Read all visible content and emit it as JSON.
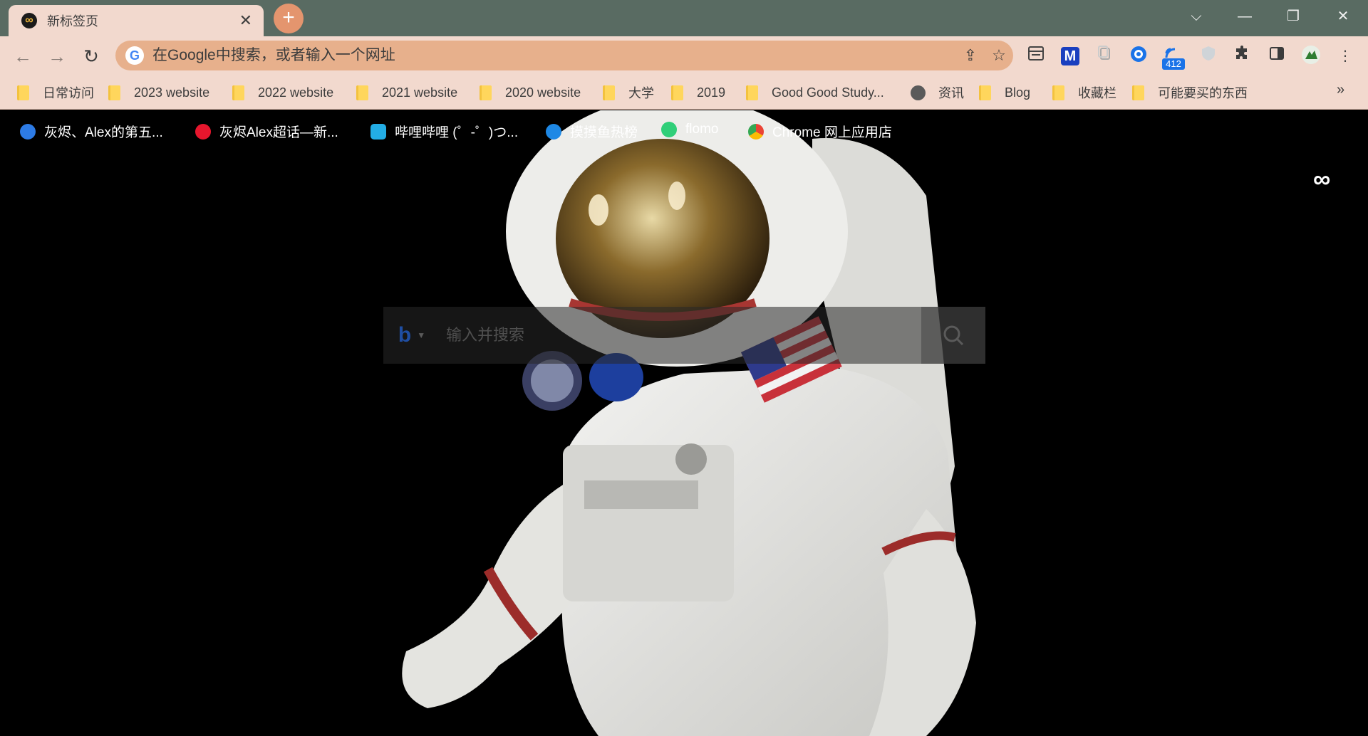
{
  "tab": {
    "title": "新标签页",
    "close": "✕",
    "favicon": "∞"
  },
  "newtab": {
    "label": "+"
  },
  "window": {
    "dropdown": "⌵",
    "minimize": "—",
    "restore": "❐",
    "close": "✕"
  },
  "nav": {
    "back": "←",
    "forward": "→",
    "reload": "↻"
  },
  "omnibox": {
    "placeholder": "在Google中搜索，或者输入一个网址",
    "logo": "G",
    "share": "⇪",
    "star": "☆"
  },
  "extensions": {
    "badge_count": "412",
    "m_label": "M",
    "puzzle": "✦",
    "menu": "⋮"
  },
  "bookmarks": [
    {
      "label": "日常访问",
      "type": "folder"
    },
    {
      "label": "2023 website",
      "type": "folder"
    },
    {
      "label": "2022 website",
      "type": "folder"
    },
    {
      "label": "2021 website",
      "type": "folder"
    },
    {
      "label": "2020 website",
      "type": "folder"
    },
    {
      "label": "大学",
      "type": "folder"
    },
    {
      "label": "2019",
      "type": "folder"
    },
    {
      "label": "Good Good Study...",
      "type": "folder"
    },
    {
      "label": "资讯",
      "type": "globe"
    },
    {
      "label": "Blog",
      "type": "folder"
    },
    {
      "label": "收藏栏",
      "type": "folder"
    },
    {
      "label": "可能要买的东西",
      "type": "folder"
    }
  ],
  "bookmarks_more": "»",
  "shortcuts": [
    {
      "label": "灰烬、Alex的第五...",
      "color": "#2d7be5"
    },
    {
      "label": "灰烬Alex超话—新...",
      "color": "#e6162d"
    },
    {
      "label": "哔哩哔哩 (゜-゜)つ...",
      "color": "#23ade5"
    },
    {
      "label": "摸摸鱼热榜",
      "color": "#1e88e5"
    },
    {
      "label": "flomo",
      "color": "#30cf79"
    },
    {
      "label": "Chrome 网上应用店",
      "color": "#ea4335"
    }
  ],
  "page": {
    "infinity": "∞"
  },
  "search": {
    "placeholder": "输入并搜索",
    "engine": "b",
    "caret": "▼"
  },
  "colors": {
    "tabstrip": "#596b62",
    "chrome": "#f2d9ce",
    "omnibox": "#e7b08c",
    "newtab": "#e4956e"
  }
}
